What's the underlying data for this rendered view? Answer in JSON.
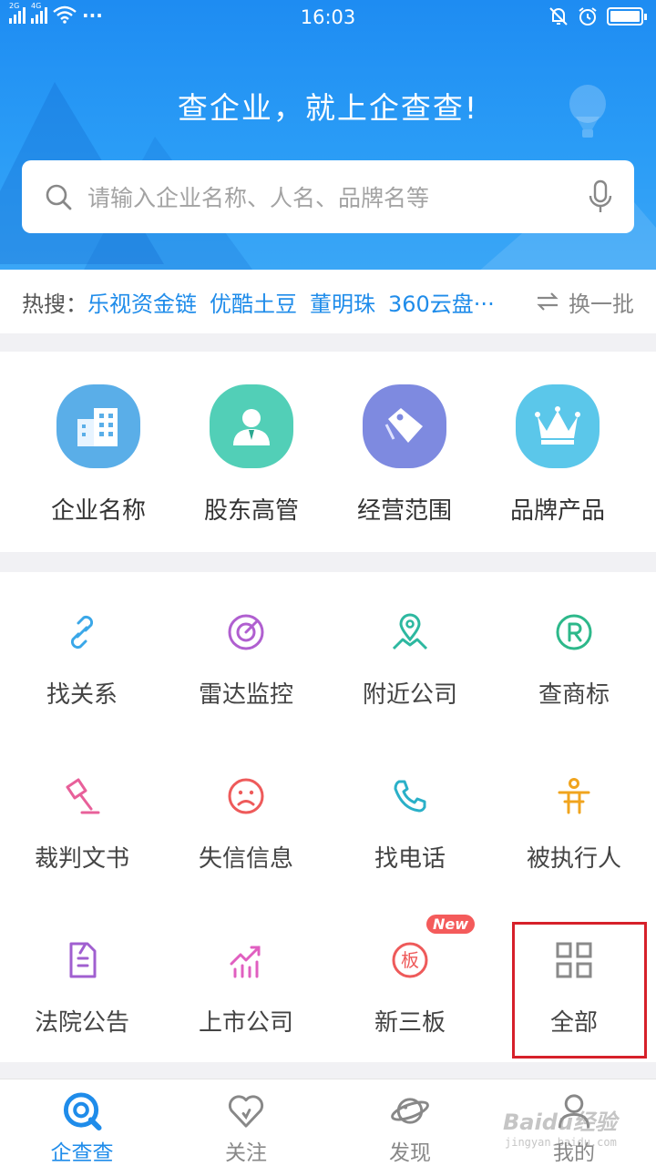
{
  "status_bar": {
    "time": "16:03",
    "net1": "2G",
    "net2": "4G",
    "more": "···"
  },
  "header": {
    "slogan": "查企业，就上企查查!"
  },
  "search": {
    "placeholder": "请输入企业名称、人名、品牌名等"
  },
  "hot": {
    "label": "热搜：",
    "items": [
      "乐视资金链",
      "优酷土豆",
      "董明珠",
      "360云盘···"
    ],
    "refresh": "换一批"
  },
  "categories": [
    {
      "label": "企业名称",
      "icon": "building-icon",
      "color": "#5aaee8"
    },
    {
      "label": "股东高管",
      "icon": "person-icon",
      "color": "#52cfb7"
    },
    {
      "label": "经营范围",
      "icon": "tag-icon",
      "color": "#7e8ae0"
    },
    {
      "label": "品牌产品",
      "icon": "crown-icon",
      "color": "#5bc7ea"
    }
  ],
  "tools": [
    {
      "label": "找关系",
      "icon": "link-icon",
      "color": "#3aa7e8"
    },
    {
      "label": "雷达监控",
      "icon": "radar-icon",
      "color": "#b05fd0"
    },
    {
      "label": "附近公司",
      "icon": "location-pin-icon",
      "color": "#2db8a0"
    },
    {
      "label": "查商标",
      "icon": "trademark-icon",
      "color": "#2db88a"
    },
    {
      "label": "裁判文书",
      "icon": "gavel-icon",
      "color": "#e8609a"
    },
    {
      "label": "失信信息",
      "icon": "sad-face-icon",
      "color": "#ee5a5a"
    },
    {
      "label": "找电话",
      "icon": "phone-icon",
      "color": "#2ab0c8"
    },
    {
      "label": "被执行人",
      "icon": "person-restricted-icon",
      "color": "#f0a41e"
    },
    {
      "label": "法院公告",
      "icon": "document-icon",
      "color": "#a05fd0"
    },
    {
      "label": "上市公司",
      "icon": "trend-chart-icon",
      "color": "#e05fc0"
    },
    {
      "label": "新三板",
      "icon": "board-seal-icon",
      "color": "#ee5a5a",
      "badge": "New",
      "seal_char": "板"
    },
    {
      "label": "全部",
      "icon": "grid-icon",
      "color": "#8a8a8a"
    }
  ],
  "tabs": [
    {
      "label": "企查查",
      "icon": "qcc-logo-icon",
      "active": true
    },
    {
      "label": "关注",
      "icon": "heart-icon",
      "active": false
    },
    {
      "label": "发现",
      "icon": "planet-icon",
      "active": false
    },
    {
      "label": "我的",
      "icon": "user-icon",
      "active": false
    }
  ],
  "watermark": {
    "main": "Baidu经验",
    "sub": "jingyan.baidu.com"
  }
}
